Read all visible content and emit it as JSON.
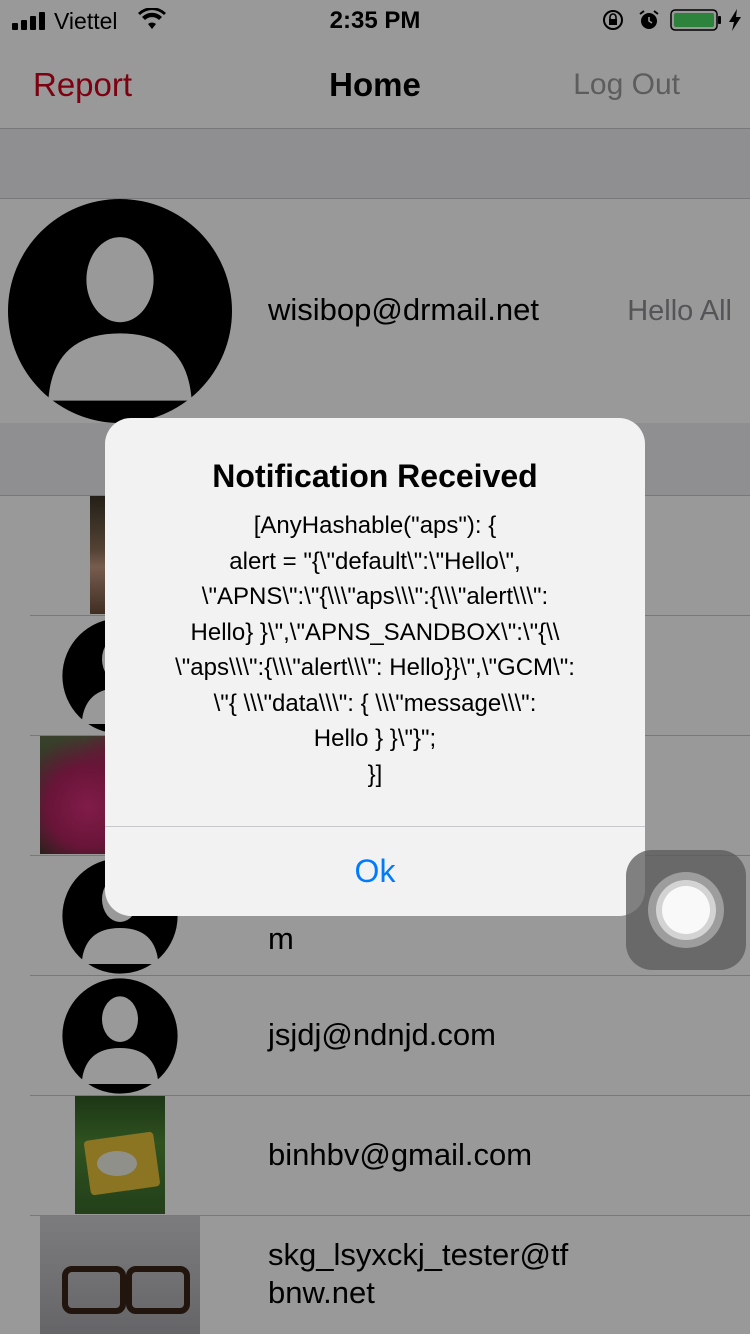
{
  "status_bar": {
    "carrier": "Viettel",
    "time": "2:35 PM",
    "battery_color": "#4cd964"
  },
  "nav": {
    "left_label": "Report",
    "title": "Home",
    "right_label": "Log Out",
    "left_color": "#d0021b"
  },
  "profile": {
    "email": "wisibop@drmail.net",
    "status": "Hello All",
    "avatar_icon": "person-silhouette-icon"
  },
  "users": [
    {
      "email": "",
      "avatar": "photo-face"
    },
    {
      "email": "",
      "avatar": "person-silhouette-icon"
    },
    {
      "email": "",
      "avatar": "photo-flowers"
    },
    {
      "email": "m",
      "avatar": "person-silhouette-icon"
    },
    {
      "email": "jsjdj@ndnjd.com",
      "avatar": "person-silhouette-icon"
    },
    {
      "email": "binhbv@gmail.com",
      "avatar": "photo-plant"
    },
    {
      "email": "skg_lsyxckj_tester@tf\nbnw.net",
      "avatar": "photo-glasses"
    }
  ],
  "alert": {
    "title": "Notification Received",
    "message": "[AnyHashable(\"aps\"): {\n    alert = \"{\\\"default\\\":\\\"Hello\\\",\n\\\"APNS\\\":\\\"{\\\\\\\"aps\\\\\\\":{\\\\\\\"alert\\\\\\\":\nHello} }\\\",\\\"APNS_SANDBOX\\\":\\\"{\\\\\n\\\"aps\\\\\\\":{\\\\\\\"alert\\\\\\\": Hello}}\\\",\\\"GCM\\\":\n\\\"{ \\\\\\\"data\\\\\\\": { \\\\\\\"message\\\\\\\":\nHello } }\\\"}\";\n}]",
    "button": "Ok",
    "button_color": "#007aff"
  }
}
